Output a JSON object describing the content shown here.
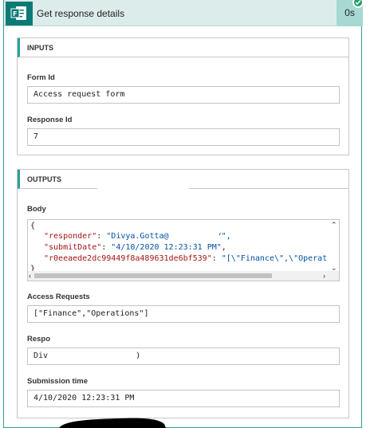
{
  "action": {
    "title": "Get response details",
    "duration": "0s"
  },
  "inputs": {
    "header": "INPUTS",
    "form_id_label": "Form Id",
    "form_id_value": "Access request form",
    "response_id_label": "Response Id",
    "response_id_value": "7"
  },
  "outputs": {
    "header": "OUTPUTS",
    "body_label": "Body",
    "body_lines": {
      "open": "{",
      "responder_key": "\"responder\"",
      "responder_value": "\"Divya.Gotta@",
      "responder_tail": "/\",",
      "submit_key": "\"submitDate\"",
      "submit_value": "\"4/10/2020 12:23:31 PM\"",
      "question_key": "\"r0eeaede2dc99449f8a489631de6bf539\"",
      "question_value": "\"[\\\"Finance\\\",\\\"Operat",
      "close": "}"
    },
    "access_requests_label": "Access Requests",
    "access_requests_value": "[\"Finance\",\"Operations\"]",
    "responder_label": "Respo",
    "responder_value": "Div",
    "responder_tail": ")",
    "submission_time_label": "Submission time",
    "submission_time_value": "4/10/2020 12:23:31 PM"
  }
}
